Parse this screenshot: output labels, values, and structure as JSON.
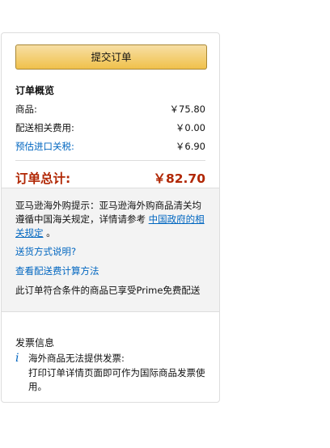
{
  "order": {
    "place_order_label": "提交订单",
    "summary_title": "订单概览",
    "items_label": "商品:",
    "items_value": "￥75.80",
    "shipping_label": "配送相关费用:",
    "shipping_value": "￥0.00",
    "tax_label": "预估进口关税:",
    "tax_value": "￥6.90",
    "total_label": "订单总计:",
    "total_value": "￥82.70"
  },
  "notice": {
    "prefix": "亚马逊海外购提示：亚马逊海外购商品清关均遵循中国海关规定，详情请参考",
    "link": "中国政府的相关规定",
    "suffix": "。",
    "shipping_method_link": "送货方式说明?",
    "shipping_fee_link": "查看配送费计算方法",
    "prime_text": "此订单符合条件的商品已享受Prime免费配送"
  },
  "invoice": {
    "title": "发票信息",
    "line1": "海外商品无法提供发票:",
    "line2": "打印订单详情页面即可作为国际商品发票使用。"
  },
  "colors": {
    "accent_link": "#0066c0",
    "total_red": "#b12704",
    "button_yellow": "#f0c14b"
  }
}
